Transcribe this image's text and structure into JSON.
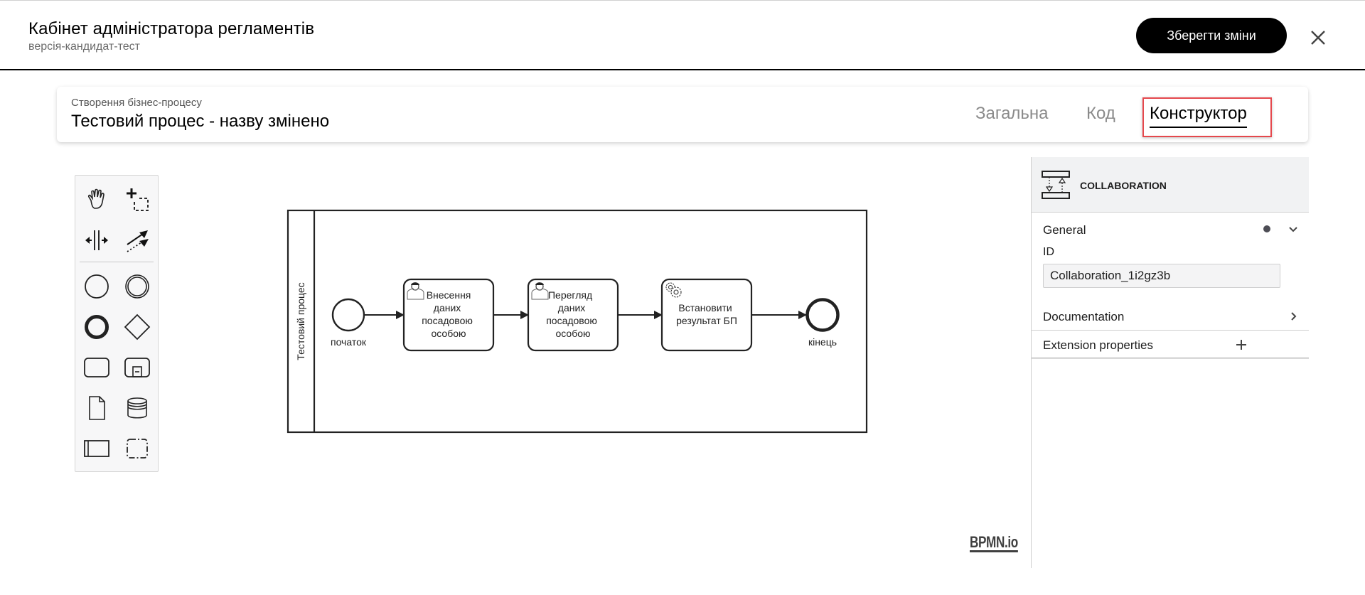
{
  "header": {
    "title": "Кабінет адміністратора регламентів",
    "subtitle": "версія-кандидат-тест",
    "save_label": "Зберегти зміни",
    "close_icon": "close-icon"
  },
  "process": {
    "caption": "Створення бізнес-процесу",
    "title": "Тестовий процес - назву змінено",
    "tabs": [
      {
        "label": "Загальна",
        "active": false
      },
      {
        "label": "Код",
        "active": false
      },
      {
        "label": "Конструктор",
        "active": true
      }
    ],
    "highlight_color": "#e5484d"
  },
  "palette": {
    "tools": [
      {
        "name": "hand-tool",
        "icon": "hand-icon"
      },
      {
        "name": "lasso-tool",
        "icon": "lasso-icon"
      },
      {
        "name": "space-tool",
        "icon": "space-tool-icon"
      },
      {
        "name": "global-connect-tool",
        "icon": "connect-icon"
      },
      {
        "name": "create-start-event",
        "icon": "start-event-icon"
      },
      {
        "name": "create-intermediate-event",
        "icon": "intermediate-event-icon"
      },
      {
        "name": "create-end-event",
        "icon": "end-event-icon"
      },
      {
        "name": "create-gateway",
        "icon": "gateway-icon"
      },
      {
        "name": "create-task",
        "icon": "task-icon"
      },
      {
        "name": "create-subprocess",
        "icon": "subprocess-icon"
      },
      {
        "name": "create-data-object",
        "icon": "data-object-icon"
      },
      {
        "name": "create-data-store",
        "icon": "data-store-icon"
      },
      {
        "name": "create-participant",
        "icon": "participant-icon"
      },
      {
        "name": "create-group",
        "icon": "group-icon"
      }
    ]
  },
  "diagram": {
    "pool_label": "Тестовий процес",
    "start_event": {
      "label": "початок"
    },
    "tasks": [
      {
        "type": "user",
        "lines": [
          "Внесення",
          "даних",
          "посадовою",
          "особою"
        ]
      },
      {
        "type": "user",
        "lines": [
          "Перегляд",
          "даних",
          "посадовою",
          "особою"
        ]
      },
      {
        "type": "service",
        "lines": [
          "Встановити",
          "результат БП"
        ]
      }
    ],
    "end_event": {
      "label": "кінець"
    },
    "watermark": "BPMN.io"
  },
  "properties": {
    "element_type": "COLLABORATION",
    "groups": [
      {
        "title": "General",
        "expanded": true,
        "has_data": true
      },
      {
        "title": "Documentation",
        "expanded": false
      },
      {
        "title": "Extension properties",
        "expanded": false,
        "addable": true
      }
    ],
    "id_label": "ID",
    "id_value": "Collaboration_1i2gz3b"
  }
}
